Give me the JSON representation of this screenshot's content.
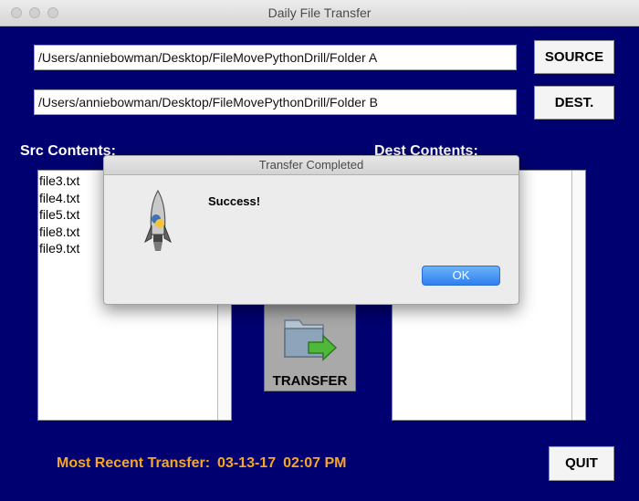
{
  "window": {
    "title": "Daily File Transfer"
  },
  "source": {
    "path": "/Users/anniebowman/Desktop/FileMovePythonDrill/Folder A",
    "button_label": "SOURCE"
  },
  "destination": {
    "path": "/Users/anniebowman/Desktop/FileMovePythonDrill/Folder B",
    "button_label": "DEST."
  },
  "src_list": {
    "label": "Src Contents:",
    "files": [
      "file3.txt",
      "file4.txt",
      "file5.txt",
      "file8.txt",
      "file9.txt"
    ]
  },
  "dest_list": {
    "label": "Dest Contents:",
    "files": []
  },
  "transfer": {
    "button_label": "TRANSFER",
    "icon": "folder-transfer-icon"
  },
  "recent": {
    "label": "Most Recent Transfer:",
    "date": "03-13-17",
    "time": "02:07 PM"
  },
  "quit": {
    "button_label": "QUIT"
  },
  "dialog": {
    "title": "Transfer Completed",
    "message": "Success!",
    "ok_label": "OK",
    "icon": "python-rocket-icon"
  },
  "colors": {
    "window_bg": "#000070",
    "recent_text": "#f5a623",
    "ok_button": "#2f7fef"
  }
}
